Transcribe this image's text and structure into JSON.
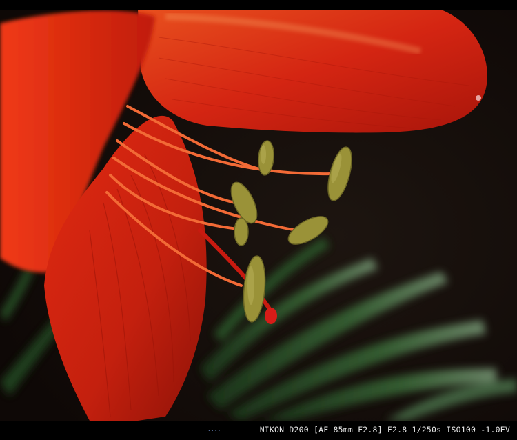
{
  "photo": {
    "subject": "red lily",
    "colors": {
      "petal": "#d8220e",
      "petal_light": "#f04a1a",
      "background": "#140c09",
      "leaf": "#2e5a2c",
      "anther": "#9a9238"
    }
  },
  "caption": {
    "exif": "NIKON D200 [AF 85mm F2.8] F2.8 1/250s ISO100 -1.0EV",
    "watermark": "...."
  }
}
